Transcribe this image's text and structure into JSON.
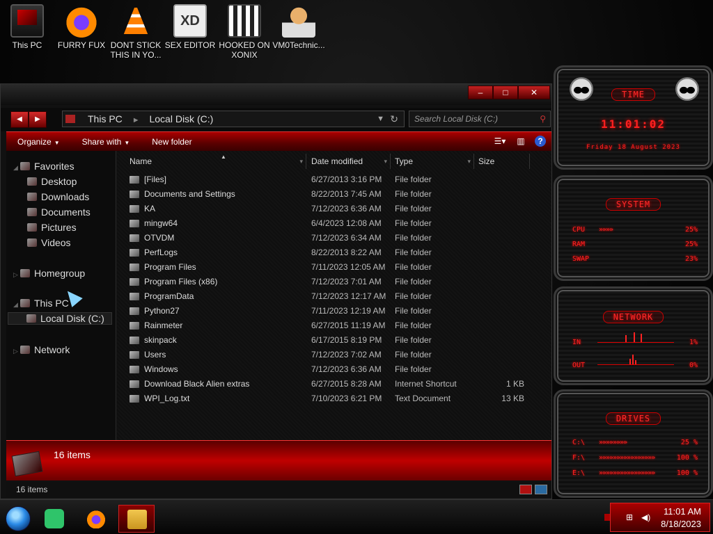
{
  "desktop": {
    "icons": [
      {
        "label": "This PC",
        "icon": "computer-icon"
      },
      {
        "label": "FURRY FUX",
        "icon": "firefox-icon"
      },
      {
        "label": "DONT STICK THIS IN YO...",
        "icon": "vlc-icon"
      },
      {
        "label": "SEX EDITOR",
        "icon": "hxd-icon"
      },
      {
        "label": "HOOKED ON XONIX",
        "icon": "game-icon"
      },
      {
        "label": "VM0Technic...",
        "icon": "doctor-icon"
      }
    ]
  },
  "explorer": {
    "caption": {
      "minimize": "–",
      "maximize": "□",
      "close": "✕"
    },
    "nav": {
      "back": "◀",
      "forward": "▶"
    },
    "address": {
      "root": "This PC",
      "separator": "►",
      "current": "Local Disk (C:)"
    },
    "search": {
      "placeholder": "Search Local Disk (C:)"
    },
    "toolbar": {
      "organize": "Organize",
      "share_with": "Share with",
      "new_folder": "New folder"
    },
    "navpane": {
      "favorites": "Favorites",
      "desktop": "Desktop",
      "downloads": "Downloads",
      "documents": "Documents",
      "pictures": "Pictures",
      "videos": "Videos",
      "homegroup": "Homegroup",
      "this_pc": "This PC",
      "local_disk": "Local Disk (C:)",
      "network": "Network"
    },
    "columns": {
      "name": "Name",
      "date": "Date modified",
      "type": "Type",
      "size": "Size"
    },
    "files": [
      {
        "name": "[Files]",
        "date": "6/27/2013 3:16 PM",
        "type": "File folder",
        "size": ""
      },
      {
        "name": "Documents and Settings",
        "date": "8/22/2013 7:45 AM",
        "type": "File folder",
        "size": ""
      },
      {
        "name": "KA",
        "date": "7/12/2023 6:36 AM",
        "type": "File folder",
        "size": ""
      },
      {
        "name": "mingw64",
        "date": "6/4/2023 12:08 AM",
        "type": "File folder",
        "size": ""
      },
      {
        "name": "OTVDM",
        "date": "7/12/2023 6:34 AM",
        "type": "File folder",
        "size": ""
      },
      {
        "name": "PerfLogs",
        "date": "8/22/2013 8:22 AM",
        "type": "File folder",
        "size": ""
      },
      {
        "name": "Program Files",
        "date": "7/11/2023 12:05 AM",
        "type": "File folder",
        "size": ""
      },
      {
        "name": "Program Files (x86)",
        "date": "7/12/2023 7:01 AM",
        "type": "File folder",
        "size": ""
      },
      {
        "name": "ProgramData",
        "date": "7/12/2023 12:17 AM",
        "type": "File folder",
        "size": ""
      },
      {
        "name": "Python27",
        "date": "7/11/2023 12:19 AM",
        "type": "File folder",
        "size": ""
      },
      {
        "name": "Rainmeter",
        "date": "6/27/2015 11:19 AM",
        "type": "File folder",
        "size": ""
      },
      {
        "name": "skinpack",
        "date": "6/17/2015 8:19 PM",
        "type": "File folder",
        "size": ""
      },
      {
        "name": "Users",
        "date": "7/12/2023 7:02 AM",
        "type": "File folder",
        "size": ""
      },
      {
        "name": "Windows",
        "date": "7/12/2023 6:36 AM",
        "type": "File folder",
        "size": ""
      },
      {
        "name": "Download Black Alien extras",
        "date": "6/27/2015 8:28 AM",
        "type": "Internet Shortcut",
        "size": "1 KB"
      },
      {
        "name": "WPI_Log.txt",
        "date": "7/10/2023 6:21 PM",
        "type": "Text Document",
        "size": "13 KB"
      }
    ],
    "details": {
      "count": "16 items"
    },
    "status": {
      "count": "16 items"
    }
  },
  "rainmeter": {
    "time": {
      "title": "TIME",
      "clock": "11:01:02",
      "date": "Friday 18 August 2023"
    },
    "system": {
      "title": "SYSTEM",
      "cpu_label": "CPU",
      "cpu_val": "25%",
      "ram_label": "RAM",
      "ram_val": "25%",
      "swap_label": "SWAP",
      "swap_val": "23%"
    },
    "network": {
      "title": "NETWORK",
      "in_label": "IN",
      "in_val": "1%",
      "out_label": "OUT",
      "out_val": "0%"
    },
    "drives": {
      "title": "DRIVES",
      "c_label": "C:\\",
      "c_val": "25 %",
      "f_label": "F:\\",
      "f_val": "100 %",
      "e_label": "E:\\",
      "e_val": "100 %"
    },
    "accent": "#ff2020"
  },
  "taskbar": {
    "apps": [
      "start-orb",
      "notes-app",
      "firefox-app",
      "file-explorer-app"
    ],
    "tray": {
      "time": "11:01 AM",
      "date": "8/18/2023"
    }
  }
}
